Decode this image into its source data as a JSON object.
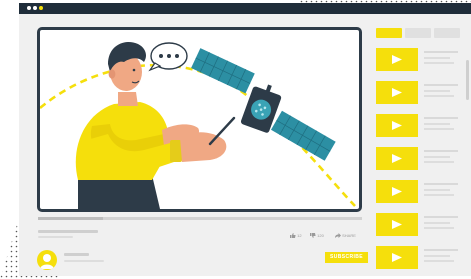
{
  "actions": {
    "like_count": "12",
    "dislike_count": "120",
    "share_label": "SHARE"
  },
  "subscribe_label": "SUBSCRIBE",
  "video": {
    "progress": 0.2
  },
  "playlist": {
    "count": 7
  },
  "colors": {
    "accent": "#F5DF0C",
    "frame": "#1F2D3A",
    "illustration_skin": "#F0A884",
    "sweater": "#F5DF0C"
  },
  "icons": [
    "play-icon",
    "thumbs-up-icon",
    "thumbs-down-icon",
    "share-icon",
    "speech-bubble-icon",
    "satellite-icon"
  ]
}
